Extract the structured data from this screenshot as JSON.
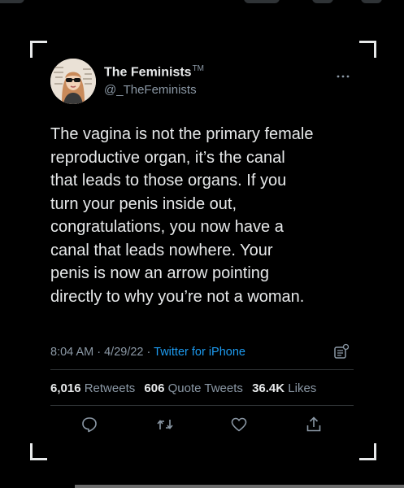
{
  "tweet": {
    "author_name": "The Feminists",
    "author_badge": "TM",
    "handle": "@_TheFeminists",
    "more_icon": "more-dots-icon",
    "text_lines": [
      "The vagina is not the primary female",
      "reproductive organ, it’s the canal",
      "that leads to those organs. If you",
      "turn your penis inside out,",
      "congratulations, you now have a",
      "canal that leads nowhere. Your",
      "penis is now an arrow pointing",
      "directly to why you’re not a woman."
    ],
    "time": "8:04 AM",
    "date": "4/29/22",
    "separator": "·",
    "source": "Twitter for iPhone",
    "analytics_icon": "analytics-icon"
  },
  "stats": {
    "retweets_count": "6,016",
    "retweets_label": "Retweets",
    "quotes_count": "606",
    "quotes_label": "Quote Tweets",
    "likes_count": "36.4K",
    "likes_label": "Likes"
  },
  "actions": [
    "reply-icon",
    "retweet-icon",
    "like-icon",
    "share-icon"
  ],
  "colors": {
    "background": "#000000",
    "text": "#e7e9ea",
    "secondary": "#8b98a5",
    "link": "#1d9bf0",
    "divider": "#2f3336"
  }
}
